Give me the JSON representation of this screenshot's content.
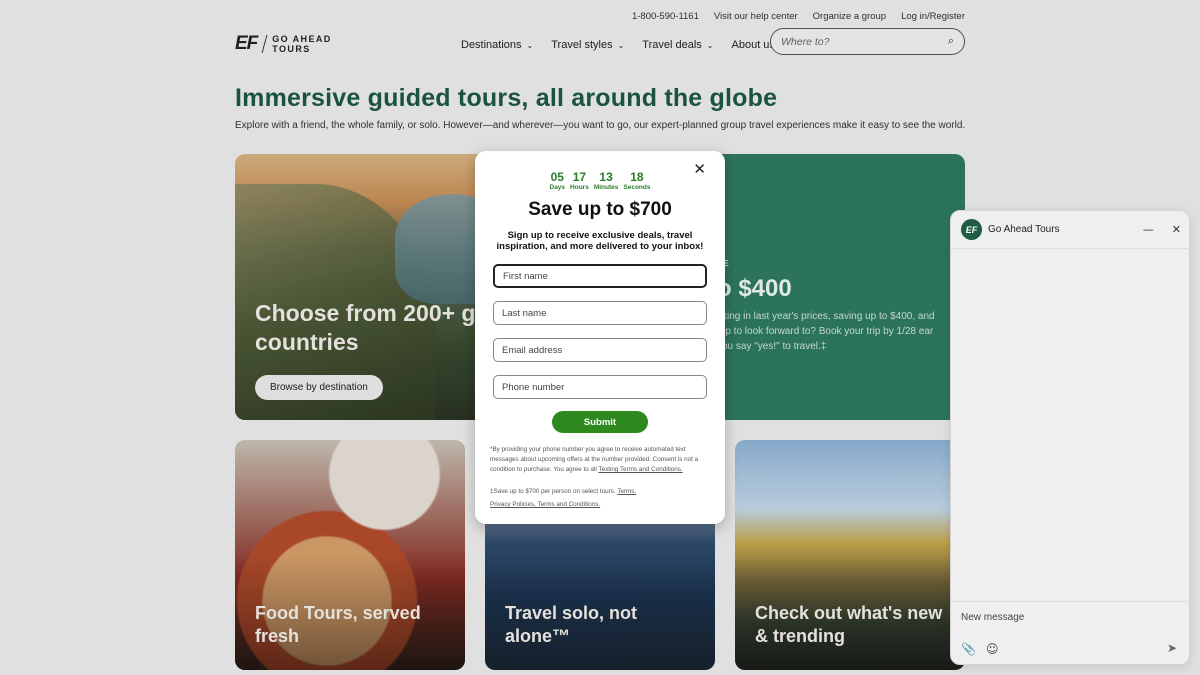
{
  "utility": {
    "phone": "1-800-590-1161",
    "help": "Visit our help center",
    "group": "Organize a group",
    "login": "Log in/Register"
  },
  "logo": {
    "mark": "EF",
    "line1": "GO AHEAD",
    "line2": "TOURS"
  },
  "nav": {
    "items": [
      {
        "label": "Destinations"
      },
      {
        "label": "Travel styles"
      },
      {
        "label": "Travel deals"
      },
      {
        "label": "About us"
      }
    ],
    "chevron": "⌄"
  },
  "search": {
    "placeholder": "Where to?",
    "icon": "search-icon"
  },
  "hero": {
    "title": "Immersive guided tours, all around the globe",
    "subtitle": "Explore with a friend, the whole family, or solo. However—and wherever—you want to go, our expert-planned group travel experiences make it easy to see the world."
  },
  "cards": {
    "big": {
      "title": "Choose from 200+ guided tours and 80+ countries",
      "button": "Browse by destination"
    },
    "deal": {
      "eyebrow": "LE",
      "price": "o $400",
      "desc": "cking in last year's prices, saving up to $400, and trip to look forward to? Book your trip by 1/28 ear you say \"yes!\" to travel.‡"
    },
    "food": "Food Tours, served fresh",
    "solo": "Travel solo, not alone™",
    "trend": "Check out what's new & trending"
  },
  "modal": {
    "close": "✕",
    "countdown": [
      {
        "num": "05",
        "label": "Days"
      },
      {
        "num": "17",
        "label": "Hours"
      },
      {
        "num": "13",
        "label": "Minutes"
      },
      {
        "num": "18",
        "label": "Seconds"
      }
    ],
    "title": "Save up to $700",
    "lead": "Sign up to receive exclusive deals, travel inspiration, and more delivered to your inbox!",
    "fields": {
      "first": "First name",
      "last": "Last name",
      "email": "Email address",
      "phone": "Phone number"
    },
    "submit": "Submit",
    "fine1": "*By providing your phone number you agree to receive automated text messages about upcoming offers at the number provided. Consent is not a condition to purchase. You agree to all",
    "fine1_link": "Texting Terms and Conditions.",
    "fine2": "‡Save up to $700 per person on select tours.",
    "fine2_link": "Terms.",
    "fine3_link": "Privacy Policies, Terms and Conditions."
  },
  "chat": {
    "avatar": "EF",
    "name": "Go Ahead Tours",
    "minimize": "—",
    "close": "✕",
    "placeholder": "New message",
    "attach": "📎",
    "emoji": "☺",
    "send": "➤"
  },
  "colors": {
    "brand_green": "#1c5a43",
    "deal_green": "#2f7b64",
    "submit_green": "#2e8a1f"
  }
}
